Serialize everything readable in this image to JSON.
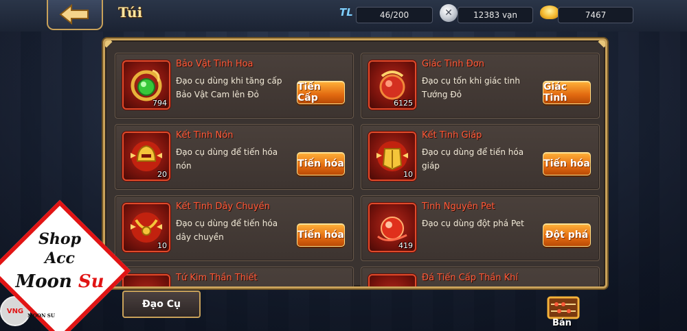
{
  "header": {
    "title": "Túi",
    "resources": [
      {
        "icon": "stamina-icon",
        "label": "TL",
        "value": "46/200"
      },
      {
        "icon": "silver-coin-icon",
        "value": "12383 vạn"
      },
      {
        "icon": "gold-ingot-icon",
        "value": "7467"
      }
    ]
  },
  "items": [
    {
      "name": "Bảo Vật Tinh Hoa",
      "desc": "Đạo cụ dùng khi tăng cấp Bảo Vật Cam lên Đỏ",
      "count": "794",
      "button": "Tiến Cấp",
      "icon": "dragon-jade-icon"
    },
    {
      "name": "Giác Tinh Đơn",
      "desc": "Đạo cụ tốn khi giác tinh Tướng Đỏ",
      "count": "6125",
      "button": "Giác Tinh",
      "icon": "dragon-orb-icon"
    },
    {
      "name": "Kết Tinh Nón",
      "desc": "Đạo cụ dùng để tiến hóa nón",
      "count": "20",
      "button": "Tiến hóa",
      "icon": "helmet-crystal-icon"
    },
    {
      "name": "Kết Tinh Giáp",
      "desc": "Đạo cụ dùng để tiến hóa giáp",
      "count": "10",
      "button": "Tiến hóa",
      "icon": "armor-crystal-icon"
    },
    {
      "name": "Kết Tinh Dây Chuyền",
      "desc": "Đạo cụ dùng để tiến hóa dây chuyền",
      "count": "10",
      "button": "Tiến hóa",
      "icon": "necklace-crystal-icon"
    },
    {
      "name": "Tinh Nguyên Pet",
      "desc": "Đạo cụ dùng đột phá Pet",
      "count": "419",
      "button": "Đột phá",
      "icon": "pet-essence-icon"
    },
    {
      "name": "Tứ Kim Thần Thiết",
      "icon": "metal-ingot-icon"
    },
    {
      "name": "Đá Tiến Cấp Thần Khí",
      "icon": "artifact-stone-icon"
    }
  ],
  "footer": {
    "tab_label": "Đạo Cụ",
    "sell_label": "Bán"
  },
  "watermark": {
    "line1": "Shop",
    "line2": "Acc",
    "line3_black": "Moon",
    "line3_red": "Su",
    "small": "MOON SU",
    "badge": "VNG"
  },
  "colors": {
    "accent_gold": "#c9a25a",
    "item_name_red": "#ff5b3a",
    "button_orange": "#e26a10"
  }
}
